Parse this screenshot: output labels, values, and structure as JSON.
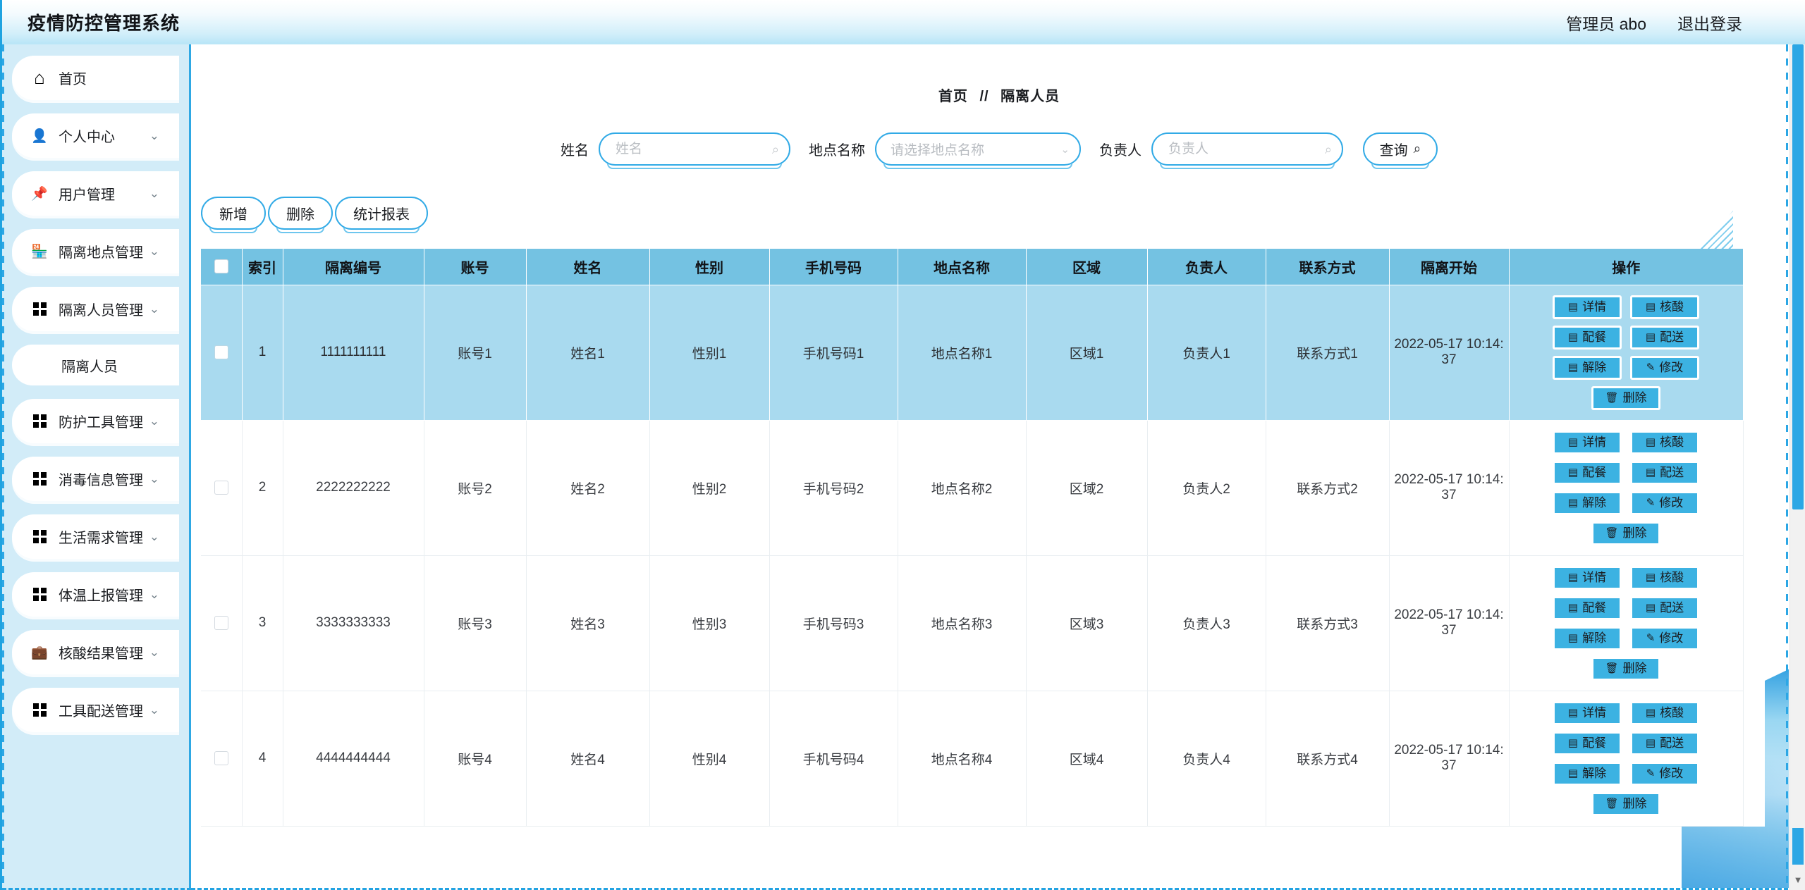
{
  "header": {
    "title": "疫情防控管理系统",
    "user": "管理员 abo",
    "logout": "退出登录"
  },
  "sidebar": {
    "items": [
      {
        "label": "首页",
        "icon": "home-icon",
        "expandable": false
      },
      {
        "label": "个人中心",
        "icon": "user-icon",
        "expandable": true,
        "chevron": "⌄"
      },
      {
        "label": "用户管理",
        "icon": "pin-icon",
        "expandable": true,
        "chevron": "⌄"
      },
      {
        "label": "隔离地点管理",
        "icon": "shop-icon",
        "expandable": true,
        "chevron": "⌄"
      },
      {
        "label": "隔离人员管理",
        "icon": "grid-icon",
        "expandable": true,
        "chevron": "⌄"
      },
      {
        "label": "防护工具管理",
        "icon": "grid-icon",
        "expandable": true,
        "chevron": "⌄"
      },
      {
        "label": "消毒信息管理",
        "icon": "grid-icon",
        "expandable": true,
        "chevron": "⌄"
      },
      {
        "label": "生活需求管理",
        "icon": "grid-icon",
        "expandable": true,
        "chevron": "⌄"
      },
      {
        "label": "体温上报管理",
        "icon": "grid-icon",
        "expandable": true,
        "chevron": "⌄"
      },
      {
        "label": "核酸结果管理",
        "icon": "briefcase-icon",
        "expandable": true,
        "chevron": "⌄"
      },
      {
        "label": "工具配送管理",
        "icon": "grid-icon",
        "expandable": true,
        "chevron": "⌄"
      }
    ],
    "submenu_label": "隔离人员",
    "submenu_after_index": 4
  },
  "breadcrumb": {
    "root": "首页",
    "separator": "//",
    "current": "隔离人员"
  },
  "filters": [
    {
      "label": "姓名",
      "placeholder": "姓名",
      "value": "",
      "icon": "search-icon",
      "type": "input"
    },
    {
      "label": "地点名称",
      "placeholder": "请选择地点名称",
      "value": "",
      "icon": "chevron-down-icon",
      "type": "select"
    },
    {
      "label": "负责人",
      "placeholder": "负责人",
      "value": "",
      "icon": "search-icon",
      "type": "input"
    }
  ],
  "search_button": {
    "label": "查询",
    "icon": "search-icon"
  },
  "toolbar": {
    "buttons": [
      {
        "label": "新增"
      },
      {
        "label": "删除"
      },
      {
        "label": "统计报表"
      }
    ]
  },
  "table": {
    "columns": [
      "",
      "索引",
      "隔离编号",
      "账号",
      "姓名",
      "性别",
      "手机号码",
      "地点名称",
      "区域",
      "负责人",
      "联系方式",
      "隔离开始",
      "操作"
    ],
    "row_actions": [
      {
        "label": "详情",
        "icon": "doc-icon",
        "glyph": "▤"
      },
      {
        "label": "核酸",
        "icon": "doc-icon",
        "glyph": "▤"
      },
      {
        "label": "配餐",
        "icon": "doc-icon",
        "glyph": "▤"
      },
      {
        "label": "配送",
        "icon": "doc-icon",
        "glyph": "▤"
      },
      {
        "label": "解除",
        "icon": "doc-icon",
        "glyph": "▤"
      },
      {
        "label": "修改",
        "icon": "pencil-icon",
        "glyph": "✎"
      },
      {
        "label": "删除",
        "icon": "trash-icon",
        "glyph": "🗑"
      }
    ],
    "rows": [
      {
        "index": "1",
        "isolation_no": "1111111111",
        "account": "账号1",
        "name": "姓名1",
        "gender": "性别1",
        "phone": "手机号码1",
        "place": "地点名称1",
        "area": "区域1",
        "manager": "负责人1",
        "contact": "联系方式1",
        "start": "2022-05-17 10:14:37",
        "highlighted": true
      },
      {
        "index": "2",
        "isolation_no": "2222222222",
        "account": "账号2",
        "name": "姓名2",
        "gender": "性别2",
        "phone": "手机号码2",
        "place": "地点名称2",
        "area": "区域2",
        "manager": "负责人2",
        "contact": "联系方式2",
        "start": "2022-05-17 10:14:37",
        "highlighted": false
      },
      {
        "index": "3",
        "isolation_no": "3333333333",
        "account": "账号3",
        "name": "姓名3",
        "gender": "性别3",
        "phone": "手机号码3",
        "place": "地点名称3",
        "area": "区域3",
        "manager": "负责人3",
        "contact": "联系方式3",
        "start": "2022-05-17 10:14:37",
        "highlighted": false
      },
      {
        "index": "4",
        "isolation_no": "4444444444",
        "account": "账号4",
        "name": "姓名4",
        "gender": "性别4",
        "phone": "手机号码4",
        "place": "地点名称4",
        "area": "区域4",
        "manager": "负责人4",
        "contact": "联系方式4",
        "start": "2022-05-17 10:14:37",
        "highlighted": false
      }
    ]
  },
  "colors": {
    "brand": "#2ca7e5",
    "header_accent": "#74c2e2",
    "row_highlight": "#a9daef",
    "button_blue": "#3cb2e2",
    "sidebar_bg": "#d2ecf8"
  }
}
